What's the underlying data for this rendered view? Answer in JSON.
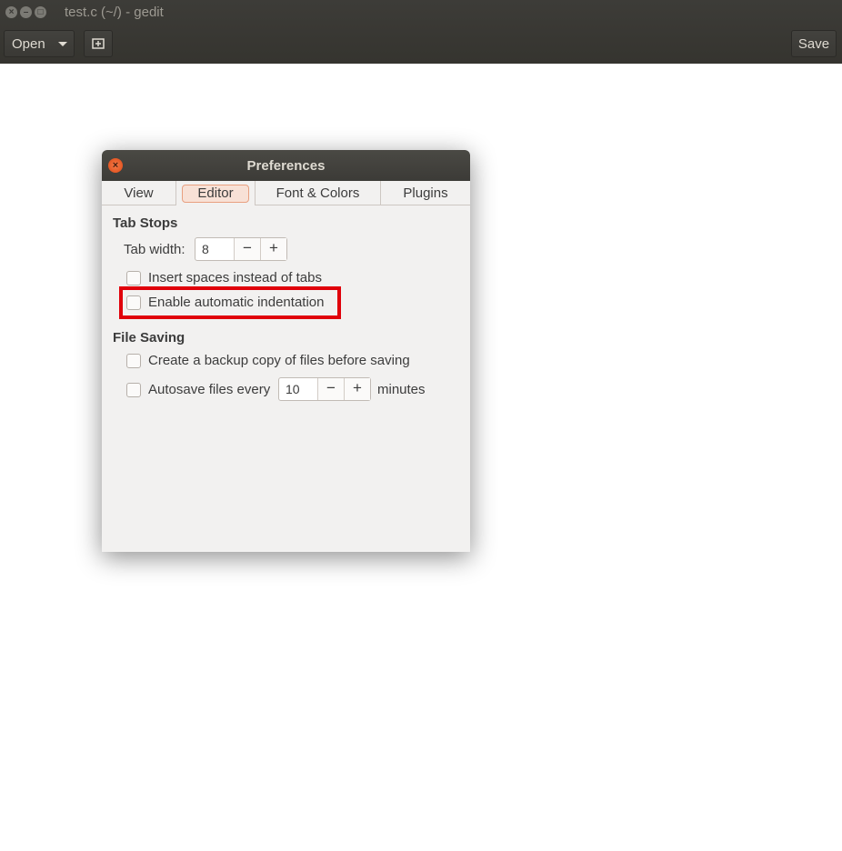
{
  "window": {
    "title": "test.c (~/) - gedit",
    "controls": {
      "close": "×",
      "minimize": "–",
      "maximize": "□"
    }
  },
  "toolbar": {
    "open_label": "Open",
    "new_tab_icon": "⊞",
    "save_label": "Save"
  },
  "dialog": {
    "title": "Preferences",
    "close_glyph": "×",
    "tabs": [
      {
        "label": "View"
      },
      {
        "label": "Editor",
        "active": true
      },
      {
        "label": "Font & Colors"
      },
      {
        "label": "Plugins"
      }
    ],
    "tab_stops": {
      "heading": "Tab Stops",
      "tab_width_label": "Tab width:",
      "tab_width_value": "8",
      "insert_spaces_label": "Insert spaces instead of tabs",
      "insert_spaces_checked": false,
      "auto_indent_label": "Enable automatic indentation",
      "auto_indent_checked": false
    },
    "file_saving": {
      "heading": "File Saving",
      "backup_label": "Create a backup copy of files before saving",
      "backup_checked": false,
      "autosave_label": "Autosave files every",
      "autosave_checked": false,
      "autosave_value": "10",
      "autosave_unit": "minutes"
    },
    "spin_minus": "−",
    "spin_plus": "+"
  },
  "colors": {
    "highlight": "#e0000a",
    "header_bg": "#3c3b37",
    "dialog_bg": "#f2f1f0",
    "close_button": "#df4a16"
  }
}
